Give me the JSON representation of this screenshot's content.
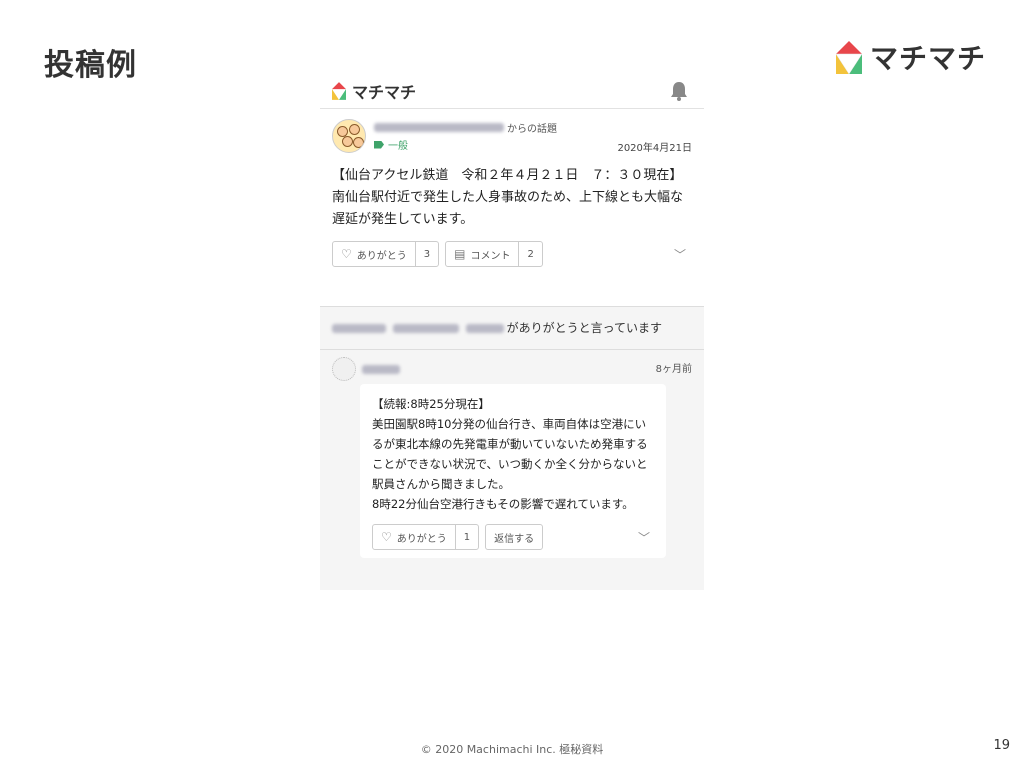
{
  "slide": {
    "title": "投稿例",
    "brand": "マチマチ",
    "footer": "© 2020 Machimachi Inc. 極秘資料",
    "page_number": "19"
  },
  "app": {
    "name": "マチマチ",
    "post": {
      "origin_suffix": "からの話題",
      "tag": "一般",
      "date": "2020年4月21日",
      "body": "【仙台アクセル鉄道　令和２年４月２１日　７：３０現在】\n南仙台駅付近で発生した人身事故のため、上下線とも大幅な遅延が発生しています。",
      "thanks_label": "ありがとう",
      "thanks_count": "3",
      "comment_label": "コメント",
      "comment_count": "2"
    },
    "thanks_line": "がありがとうと言っています",
    "comment": {
      "time": "8ヶ月前",
      "body": "【続報:8時25分現在】\n美田園駅8時10分発の仙台行き、車両自体は空港にいるが東北本線の先発電車が動いていないため発車することができない状況で、いつ動くか全く分からないと駅員さんから聞きました。\n8時22分仙台空港行きもその影響で遅れています。",
      "thanks_label": "ありがとう",
      "thanks_count": "1",
      "reply_label": "返信する"
    }
  },
  "icons": [
    "logo-icon",
    "bell-icon",
    "heart-icon",
    "comment-icon",
    "tag-icon",
    "chevron-down-icon"
  ],
  "colors": {
    "logo_red": "#e8464b",
    "logo_yellow": "#f3c33b",
    "logo_green": "#4bbd7b",
    "tag_green": "#3fa36a"
  }
}
